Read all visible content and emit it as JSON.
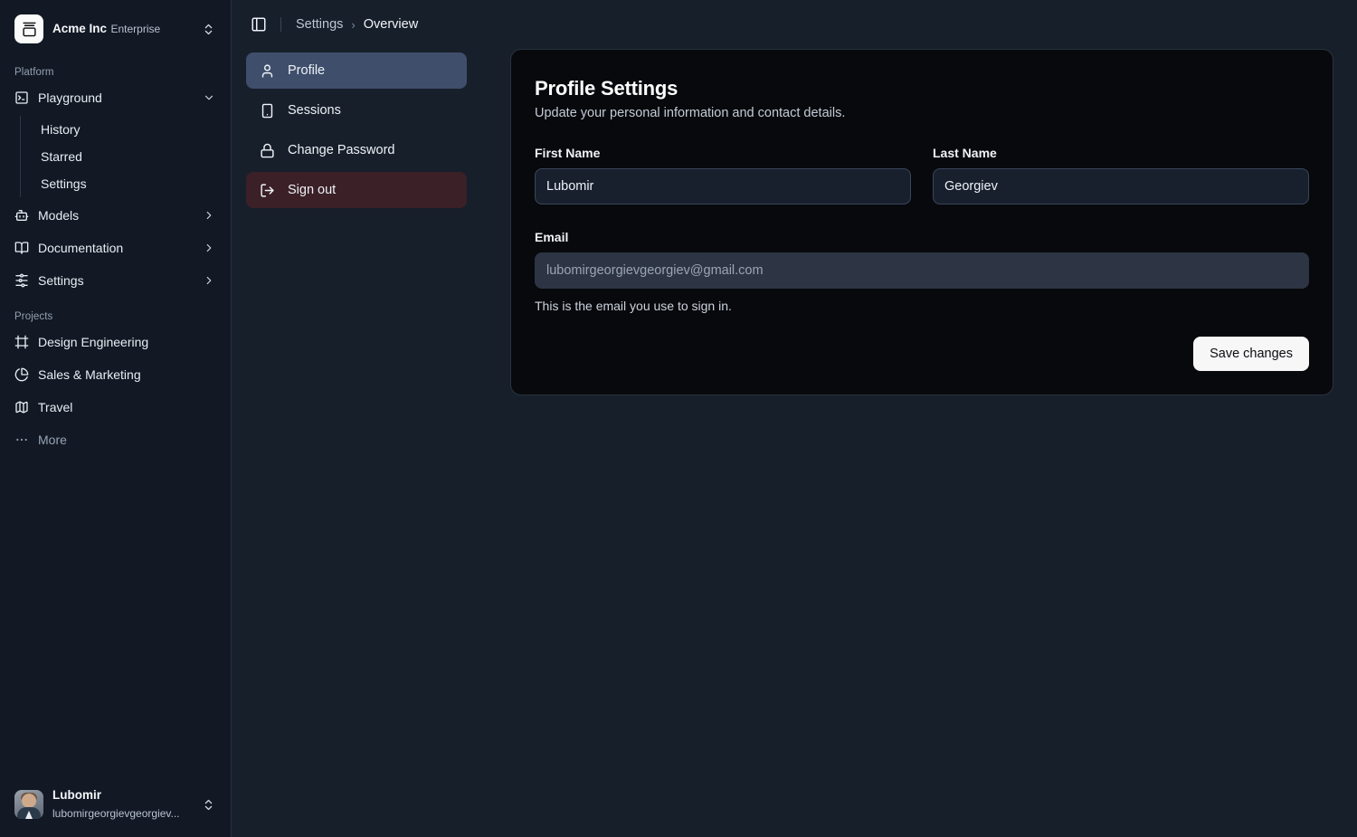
{
  "sidebar": {
    "team": {
      "name": "Acme Inc",
      "plan": "Enterprise",
      "logo_icon": "gallery-vertical-end-icon",
      "switcher_icon": "chevrons-up-down-icon"
    },
    "groups": [
      {
        "label": "Platform",
        "items": [
          {
            "label": "Playground",
            "icon": "terminal-square-icon",
            "trailing_icon": "chevron-down-icon",
            "expanded": true,
            "children": [
              {
                "label": "History"
              },
              {
                "label": "Starred"
              },
              {
                "label": "Settings"
              }
            ]
          },
          {
            "label": "Models",
            "icon": "bot-icon",
            "trailing_icon": "chevron-right-icon"
          },
          {
            "label": "Documentation",
            "icon": "book-open-icon",
            "trailing_icon": "chevron-right-icon"
          },
          {
            "label": "Settings",
            "icon": "settings-sliders-icon",
            "trailing_icon": "chevron-right-icon"
          }
        ]
      },
      {
        "label": "Projects",
        "items": [
          {
            "label": "Design Engineering",
            "icon": "frame-icon"
          },
          {
            "label": "Sales & Marketing",
            "icon": "pie-chart-icon"
          },
          {
            "label": "Travel",
            "icon": "map-icon"
          },
          {
            "label": "More",
            "icon": "more-horizontal-icon",
            "dim": true
          }
        ]
      }
    ],
    "user": {
      "name": "Lubomir",
      "email": "lubomirgeorgievgeorgiev...",
      "avatar": "user-photo-avatar",
      "switcher_icon": "chevrons-up-down-icon"
    }
  },
  "topbar": {
    "toggle_icon": "panel-left-icon",
    "breadcrumb": {
      "parent": "Settings",
      "separator": "›",
      "current": "Overview"
    }
  },
  "settings_nav": {
    "items": [
      {
        "label": "Profile",
        "icon": "user-icon",
        "state": "active"
      },
      {
        "label": "Sessions",
        "icon": "smartphone-icon",
        "state": "default"
      },
      {
        "label": "Change Password",
        "icon": "lock-icon",
        "state": "default"
      },
      {
        "label": "Sign out",
        "icon": "log-out-icon",
        "state": "danger"
      }
    ]
  },
  "card": {
    "title": "Profile Settings",
    "description": "Update your personal information and contact details.",
    "fields": {
      "first_name": {
        "label": "First Name",
        "value": "Lubomir",
        "placeholder": "First Name"
      },
      "last_name": {
        "label": "Last Name",
        "value": "Georgiev",
        "placeholder": "Last Name"
      },
      "email": {
        "label": "Email",
        "value": "",
        "placeholder": "lubomirgeorgievgeorgiev@gmail.com",
        "help": "This is the email you use to sign in."
      }
    },
    "save_label": "Save changes"
  },
  "colors": {
    "sidebar_bg": "#121925",
    "main_bg": "#171f2b",
    "card_bg": "#08090c",
    "accent_active": "#3f4e6b",
    "danger_bg": "#3b2027",
    "button_bg": "#f7f7f8",
    "input_bg": "#18202e",
    "input_flat_bg": "#2d3544"
  }
}
